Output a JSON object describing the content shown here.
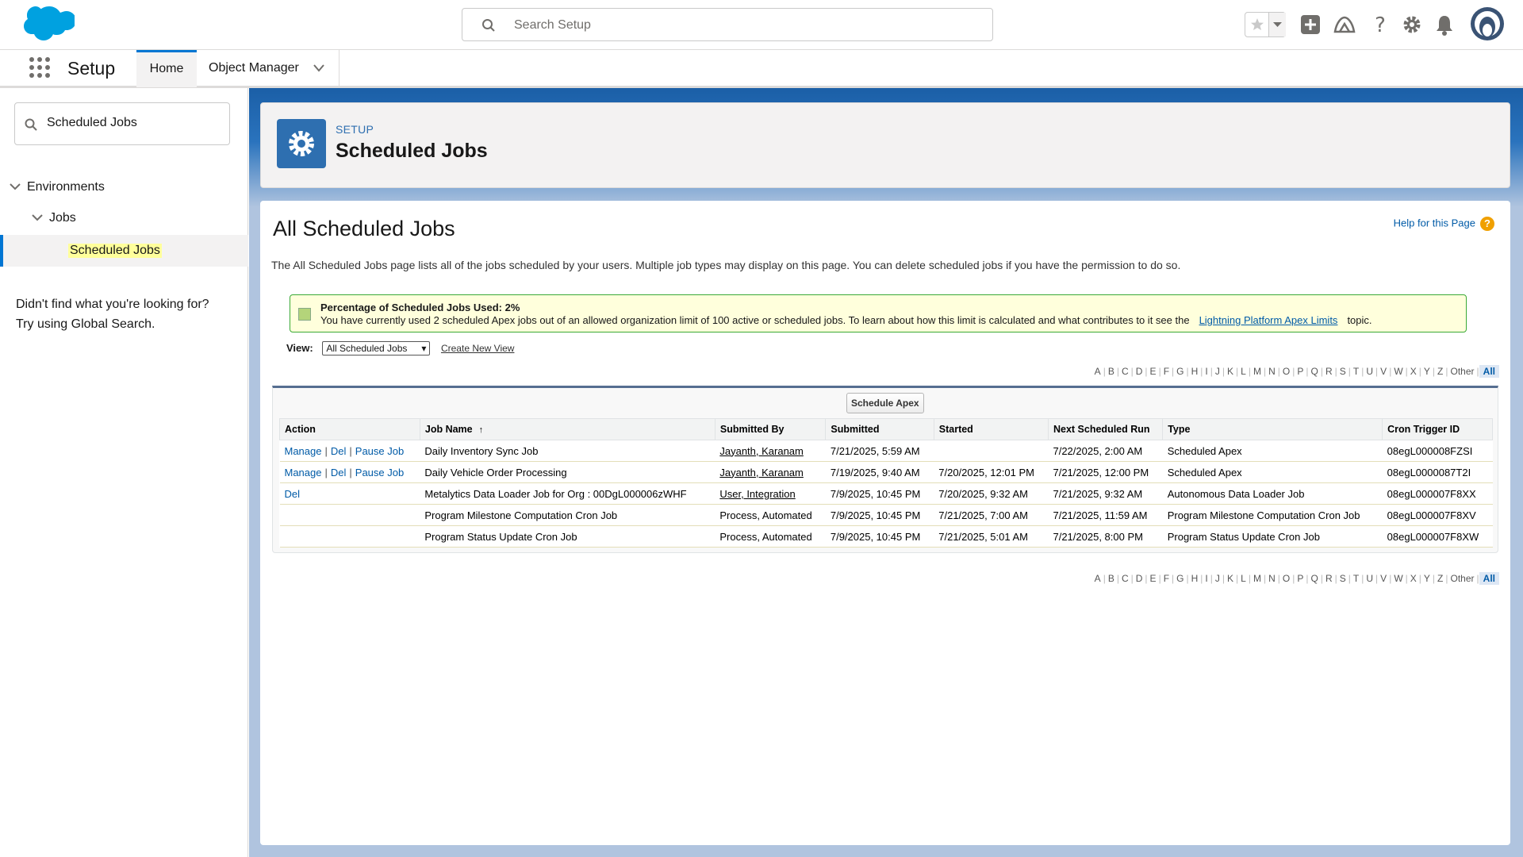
{
  "header": {
    "search_placeholder": "Search Setup",
    "icons": [
      "favorites-star-icon",
      "favorites-dropdown-icon",
      "global-actions-add-icon",
      "trailhead-icon",
      "help-icon",
      "setup-gear-icon",
      "notifications-bell-icon",
      "user-avatar"
    ]
  },
  "nav": {
    "app_name": "Setup",
    "tabs": [
      {
        "label": "Home"
      },
      {
        "label": "Object Manager"
      }
    ]
  },
  "sidebar": {
    "quick_find_value": "Scheduled Jobs",
    "tree": [
      {
        "label": "Environments"
      },
      {
        "label": "Jobs"
      },
      {
        "label": "Scheduled Jobs"
      }
    ],
    "not_found_line1": "Didn't find what you're looking for?",
    "not_found_line2": "Try using Global Search."
  },
  "page_header": {
    "breadcrumb": "SETUP",
    "title": "Scheduled Jobs"
  },
  "panel": {
    "title": "All Scheduled Jobs",
    "help_link": "Help for this Page",
    "description": "The All Scheduled Jobs page lists all of the jobs scheduled by your users. Multiple job types may display on this page. You can delete scheduled jobs if you have the permission to do so.",
    "message": {
      "title": "Percentage of Scheduled Jobs Used: 2%",
      "text": "You have currently used 2 scheduled Apex jobs out of an allowed organization limit of 100 active or scheduled jobs. To learn about how this limit is calculated and what contributes to it see the",
      "link": "Lightning Platform Apex Limits",
      "suffix": "topic."
    },
    "view_label": "View:",
    "view_value": "All Scheduled Jobs",
    "create_view": "Create New View",
    "alphabet": [
      "A",
      "B",
      "C",
      "D",
      "E",
      "F",
      "G",
      "H",
      "I",
      "J",
      "K",
      "L",
      "M",
      "N",
      "O",
      "P",
      "Q",
      "R",
      "S",
      "T",
      "U",
      "V",
      "W",
      "X",
      "Y",
      "Z",
      "Other",
      "All"
    ],
    "schedule_button": "Schedule Apex",
    "columns": [
      "Action",
      "Job Name",
      "Submitted By",
      "Submitted",
      "Started",
      "Next Scheduled Run",
      "Type",
      "Cron Trigger ID"
    ],
    "sort_indicator": "↑",
    "rows": [
      {
        "actions": [
          "Manage",
          "Del",
          "Pause Job"
        ],
        "job": "Daily Inventory Sync Job",
        "by": "Jayanth, Karanam",
        "by_link": true,
        "submitted": "7/21/2025, 5:59 AM",
        "started": "",
        "next": "7/22/2025, 2:00 AM",
        "type": "Scheduled Apex",
        "cron": "08egL000008FZSI"
      },
      {
        "actions": [
          "Manage",
          "Del",
          "Pause Job"
        ],
        "job": "Daily Vehicle Order Processing",
        "by": "Jayanth, Karanam",
        "by_link": true,
        "submitted": "7/19/2025, 9:40 AM",
        "started": "7/20/2025, 12:01 PM",
        "next": "7/21/2025, 12:00 PM",
        "type": "Scheduled Apex",
        "cron": "08egL0000087T2I"
      },
      {
        "actions": [
          "Del"
        ],
        "job": "Metalytics Data Loader Job for Org : 00DgL000006zWHF",
        "by": "User, Integration",
        "by_link": true,
        "submitted": "7/9/2025, 10:45 PM",
        "started": "7/20/2025, 9:32 AM",
        "next": "7/21/2025, 9:32 AM",
        "type": "Autonomous Data Loader Job",
        "cron": "08egL000007F8XX"
      },
      {
        "actions": [],
        "job": "Program Milestone Computation Cron Job",
        "by": "Process, Automated",
        "by_link": false,
        "submitted": "7/9/2025, 10:45 PM",
        "started": "7/21/2025, 7:00 AM",
        "next": "7/21/2025, 11:59 AM",
        "type": "Program Milestone Computation Cron Job",
        "cron": "08egL000007F8XV"
      },
      {
        "actions": [],
        "job": "Program Status Update Cron Job",
        "by": "Process, Automated",
        "by_link": false,
        "submitted": "7/9/2025, 10:45 PM",
        "started": "7/21/2025, 5:01 AM",
        "next": "7/21/2025, 8:00 PM",
        "type": "Program Status Update Cron Job",
        "cron": "08egL000007F8XW"
      }
    ]
  },
  "colors": {
    "brand_blue": "#0176d3",
    "link": "#015ba7",
    "highlight": "#ffff9b",
    "message_bg": "#ffffdc",
    "message_border": "#39a935"
  }
}
